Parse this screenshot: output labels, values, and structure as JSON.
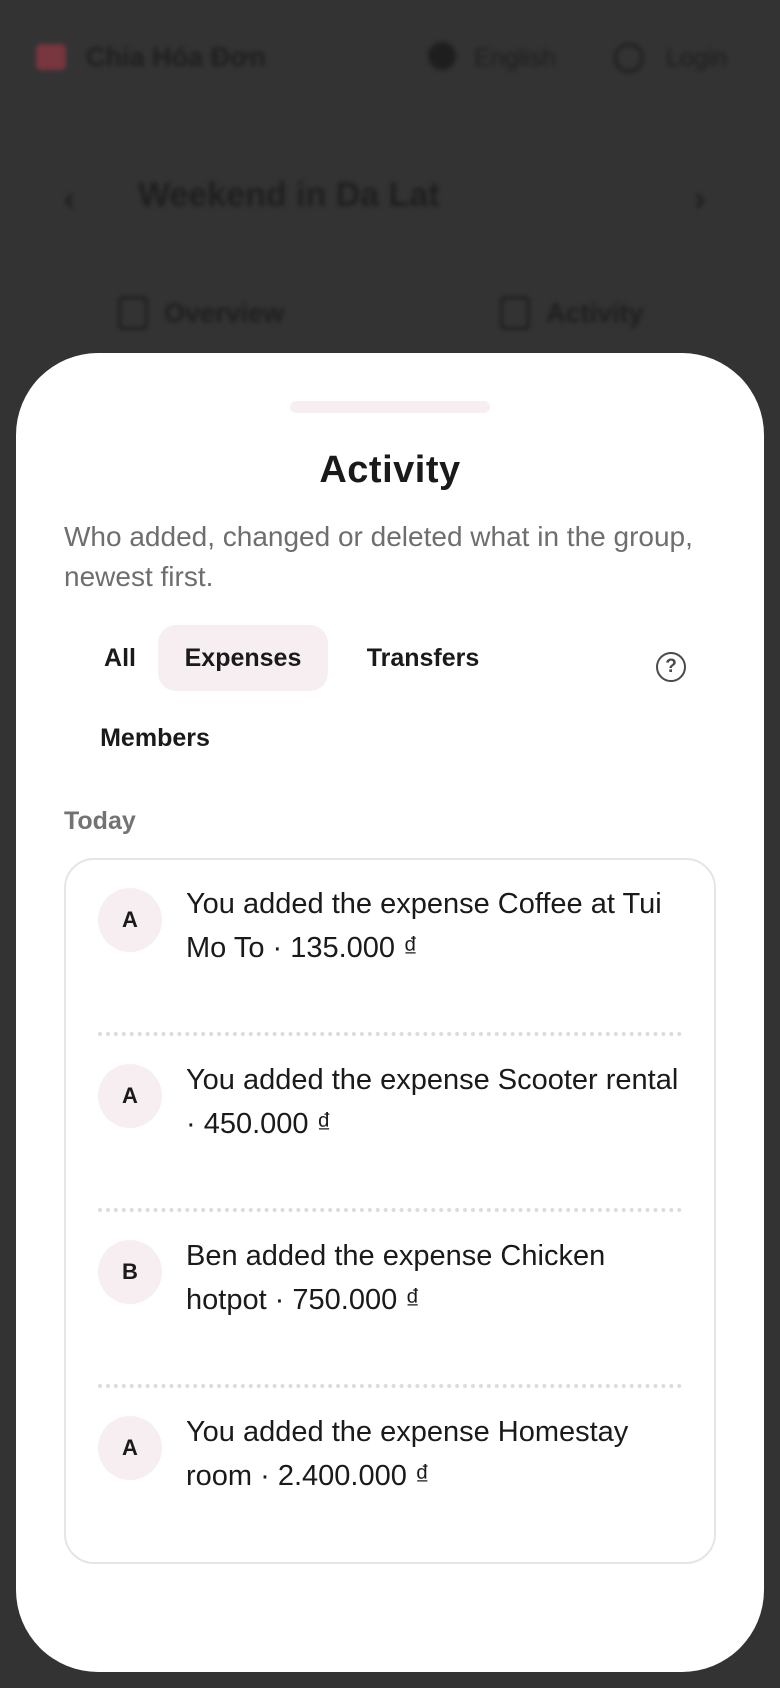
{
  "background_app": {
    "brand": "Chia Hóa Đơn",
    "language_label": "English",
    "login_label": "Login",
    "group_title": "Weekend in Da Lat",
    "back_glyph": "‹",
    "forward_glyph": "›",
    "tabs": [
      {
        "label": "Overview",
        "icon": "chart-icon"
      },
      {
        "label": "Activity",
        "icon": "clock-icon"
      }
    ]
  },
  "sheet": {
    "title": "Activity",
    "subtitle": "Who added, changed or deleted what in the group, newest first.",
    "filters": [
      {
        "label": "All",
        "active": false
      },
      {
        "label": "Expenses",
        "active": true
      },
      {
        "label": "Transfers",
        "active": false
      },
      {
        "label": "Members",
        "active": false
      }
    ],
    "help_icon": "?",
    "section_label": "Today",
    "items": [
      {
        "avatar": "A",
        "text": "You added the expense Coffee at Tui Mo To · 135.000 ₫"
      },
      {
        "avatar": "A",
        "text": "You added the expense Scooter rental · 450.000 ₫"
      },
      {
        "avatar": "B",
        "text": "Ben added the expense Chicken hotpot · 750.000 ₫"
      },
      {
        "avatar": "A",
        "text": "You added the expense Homestay room · 2.400.000 ₫"
      }
    ]
  },
  "colors": {
    "backdrop": "#333333",
    "sheet_bg": "#ffffff",
    "chip_active_bg": "#f7eef2",
    "avatar_bg": "#f7eef2",
    "text_primary": "#1a1a1a",
    "text_secondary": "#6e6e6e"
  }
}
